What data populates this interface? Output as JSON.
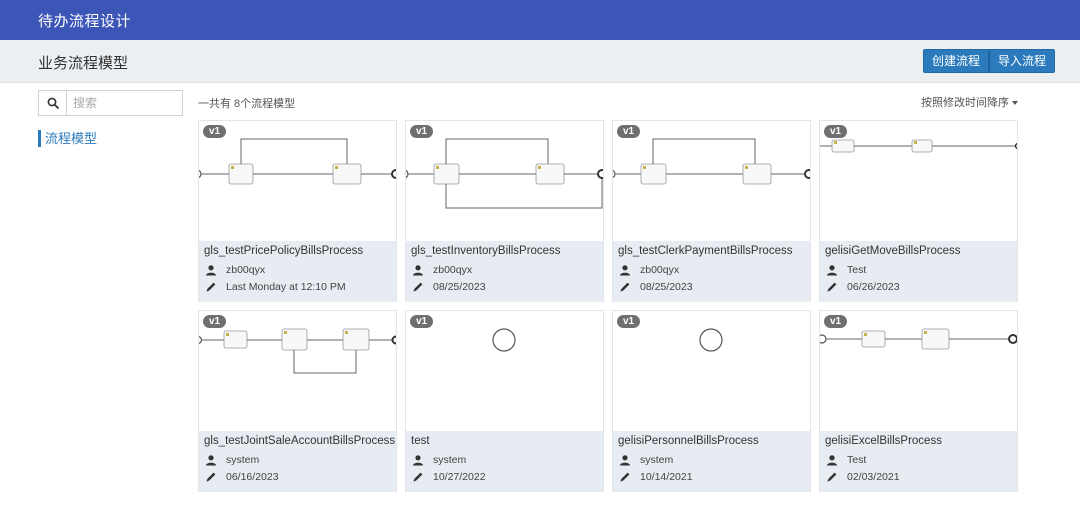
{
  "app": {
    "title": "待办流程设计"
  },
  "header": {
    "page_title": "业务流程模型",
    "create_button": "创建流程",
    "import_button": "导入流程"
  },
  "sidebar": {
    "search_placeholder": "搜索",
    "nav_item": "流程模型"
  },
  "list": {
    "count_text": "一共有 8个流程模型",
    "sort_label": "按照修改时间降序",
    "cards": [
      {
        "version": "v1",
        "name": "gls_testPricePolicyBillsProcess",
        "user": "zb00qyx",
        "date": "Last Monday at 12:10 PM"
      },
      {
        "version": "v1",
        "name": "gls_testInventoryBillsProcess",
        "user": "zb00qyx",
        "date": "08/25/2023"
      },
      {
        "version": "v1",
        "name": "gls_testClerkPaymentBillsProcess",
        "user": "zb00qyx",
        "date": "08/25/2023"
      },
      {
        "version": "v1",
        "name": "gelisiGetMoveBillsProcess",
        "user": "Test",
        "date": "06/26/2023"
      },
      {
        "version": "v1",
        "name": "gls_testJointSaleAccountBillsProcess",
        "user": "system",
        "date": "06/16/2023"
      },
      {
        "version": "v1",
        "name": "test",
        "user": "system",
        "date": "10/27/2022"
      },
      {
        "version": "v1",
        "name": "gelisiPersonnelBillsProcess",
        "user": "system",
        "date": "10/14/2021"
      },
      {
        "version": "v1",
        "name": "gelisiExcelBillsProcess",
        "user": "Test",
        "date": "02/03/2021"
      }
    ]
  },
  "icons": {
    "search": "search-icon",
    "user": "user-icon",
    "edit": "pencil-icon",
    "caret": "caret-down-icon",
    "task": "user-task-icon"
  },
  "colors": {
    "topbar": "#3c56b8",
    "primary": "#2b7bbc",
    "card_info": "#e6ecf1"
  }
}
